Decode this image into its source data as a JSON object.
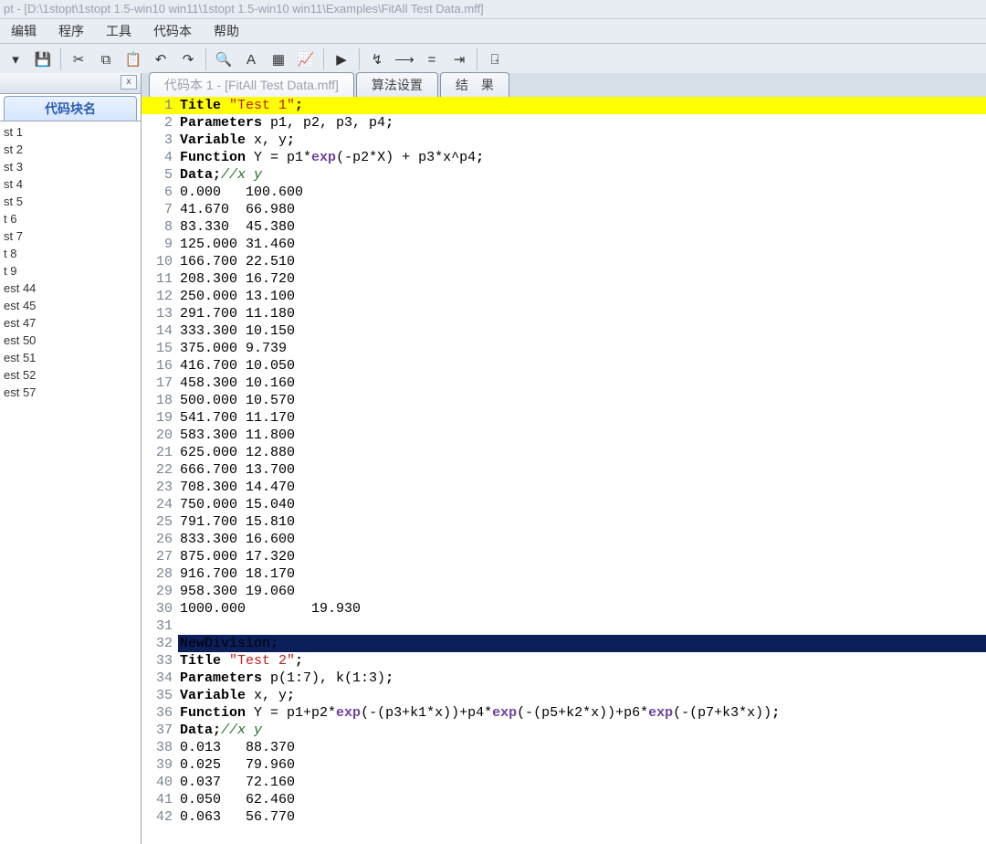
{
  "title": "pt - [D:\\1stopt\\1stopt 1.5-win10 win11\\1stopt 1.5-win10 win11\\Examples\\FitAll Test Data.mff]",
  "menu": [
    "编辑",
    "程序",
    "工具",
    "代码本",
    "帮助"
  ],
  "toolbar_icons": [
    {
      "name": "new-dropdown-icon",
      "glyph": "▾"
    },
    {
      "name": "save-icon",
      "glyph": "💾"
    },
    {
      "name": "sep"
    },
    {
      "name": "cut-icon",
      "glyph": "✂"
    },
    {
      "name": "copy-icon",
      "glyph": "⧉"
    },
    {
      "name": "paste-icon",
      "glyph": "📋"
    },
    {
      "name": "undo-icon",
      "glyph": "↶"
    },
    {
      "name": "redo-icon",
      "glyph": "↷"
    },
    {
      "name": "sep"
    },
    {
      "name": "find-icon",
      "glyph": "🔍"
    },
    {
      "name": "find-next-icon",
      "glyph": "A"
    },
    {
      "name": "sheet-icon",
      "glyph": "▦"
    },
    {
      "name": "chart-icon",
      "glyph": "📈"
    },
    {
      "name": "sep"
    },
    {
      "name": "run-icon",
      "glyph": "▶"
    },
    {
      "name": "sep"
    },
    {
      "name": "wand-icon",
      "glyph": "↯"
    },
    {
      "name": "step-icon",
      "glyph": "⟶"
    },
    {
      "name": "equals-icon",
      "glyph": "="
    },
    {
      "name": "advance-icon",
      "glyph": "⇥"
    },
    {
      "name": "sep"
    },
    {
      "name": "exit-icon",
      "glyph": "⍈"
    }
  ],
  "sidebar": {
    "tab_label": "代码块名",
    "close_x": "x",
    "items": [
      "st 1",
      "st 2",
      "st 3",
      "st 4",
      "st 5",
      "t 6",
      "st 7",
      "t 8",
      "t 9",
      "est 44",
      "est 45",
      "est 47",
      "est 50",
      "est 51",
      "est 52",
      "est 57"
    ]
  },
  "tabs": [
    {
      "label": "代码本 1 - [FitAll Test Data.mff]",
      "active": true
    },
    {
      "label": "算法设置",
      "active": false
    },
    {
      "label": "结　果",
      "active": false
    }
  ],
  "code": {
    "lines": [
      {
        "n": 1,
        "hl": "yellow",
        "tokens": [
          [
            "kw",
            "Title"
          ],
          [
            "sp",
            " "
          ],
          [
            "str",
            "\"Test 1\""
          ],
          [
            "op",
            ";"
          ]
        ]
      },
      {
        "n": 2,
        "tokens": [
          [
            "kw",
            "Parameters"
          ],
          [
            "sp",
            " "
          ],
          [
            "id",
            "p1, p2, p3, p4"
          ],
          [
            "op",
            ";"
          ]
        ]
      },
      {
        "n": 3,
        "tokens": [
          [
            "kw",
            "Variable"
          ],
          [
            "sp",
            " "
          ],
          [
            "id",
            "x, y"
          ],
          [
            "op",
            ";"
          ]
        ]
      },
      {
        "n": 4,
        "tokens": [
          [
            "kw",
            "Function"
          ],
          [
            "sp",
            " "
          ],
          [
            "id",
            "Y = p1*"
          ],
          [
            "fn",
            "exp"
          ],
          [
            "id",
            "(-p2*X) + p3*x^p4"
          ],
          [
            "op",
            ";"
          ]
        ]
      },
      {
        "n": 5,
        "tokens": [
          [
            "kw",
            "Data"
          ],
          [
            "op",
            ";"
          ],
          [
            "cm",
            "//x y"
          ]
        ]
      },
      {
        "n": 6,
        "tokens": [
          [
            "id",
            "0.000   100.600"
          ]
        ]
      },
      {
        "n": 7,
        "tokens": [
          [
            "id",
            "41.670  66.980"
          ]
        ]
      },
      {
        "n": 8,
        "tokens": [
          [
            "id",
            "83.330  45.380"
          ]
        ]
      },
      {
        "n": 9,
        "tokens": [
          [
            "id",
            "125.000 31.460"
          ]
        ]
      },
      {
        "n": 10,
        "tokens": [
          [
            "id",
            "166.700 22.510"
          ]
        ]
      },
      {
        "n": 11,
        "tokens": [
          [
            "id",
            "208.300 16.720"
          ]
        ]
      },
      {
        "n": 12,
        "tokens": [
          [
            "id",
            "250.000 13.100"
          ]
        ]
      },
      {
        "n": 13,
        "tokens": [
          [
            "id",
            "291.700 11.180"
          ]
        ]
      },
      {
        "n": 14,
        "tokens": [
          [
            "id",
            "333.300 10.150"
          ]
        ]
      },
      {
        "n": 15,
        "tokens": [
          [
            "id",
            "375.000 9.739"
          ]
        ]
      },
      {
        "n": 16,
        "tokens": [
          [
            "id",
            "416.700 10.050"
          ]
        ]
      },
      {
        "n": 17,
        "tokens": [
          [
            "id",
            "458.300 10.160"
          ]
        ]
      },
      {
        "n": 18,
        "tokens": [
          [
            "id",
            "500.000 10.570"
          ]
        ]
      },
      {
        "n": 19,
        "tokens": [
          [
            "id",
            "541.700 11.170"
          ]
        ]
      },
      {
        "n": 20,
        "tokens": [
          [
            "id",
            "583.300 11.800"
          ]
        ]
      },
      {
        "n": 21,
        "tokens": [
          [
            "id",
            "625.000 12.880"
          ]
        ]
      },
      {
        "n": 22,
        "tokens": [
          [
            "id",
            "666.700 13.700"
          ]
        ]
      },
      {
        "n": 23,
        "tokens": [
          [
            "id",
            "708.300 14.470"
          ]
        ]
      },
      {
        "n": 24,
        "tokens": [
          [
            "id",
            "750.000 15.040"
          ]
        ]
      },
      {
        "n": 25,
        "tokens": [
          [
            "id",
            "791.700 15.810"
          ]
        ]
      },
      {
        "n": 26,
        "tokens": [
          [
            "id",
            "833.300 16.600"
          ]
        ]
      },
      {
        "n": 27,
        "tokens": [
          [
            "id",
            "875.000 17.320"
          ]
        ]
      },
      {
        "n": 28,
        "tokens": [
          [
            "id",
            "916.700 18.170"
          ]
        ]
      },
      {
        "n": 29,
        "tokens": [
          [
            "id",
            "958.300 19.060"
          ]
        ]
      },
      {
        "n": 30,
        "tokens": [
          [
            "id",
            "1000.000        19.930"
          ]
        ]
      },
      {
        "n": 31,
        "tokens": [
          [
            "id",
            ""
          ]
        ]
      },
      {
        "n": 32,
        "hl": "navy",
        "tokens": [
          [
            "id",
            "NewDivision;"
          ]
        ]
      },
      {
        "n": 33,
        "tokens": [
          [
            "kw",
            "Title"
          ],
          [
            "sp",
            " "
          ],
          [
            "str",
            "\"Test 2\""
          ],
          [
            "op",
            ";"
          ]
        ]
      },
      {
        "n": 34,
        "tokens": [
          [
            "kw",
            "Parameters"
          ],
          [
            "sp",
            " "
          ],
          [
            "id",
            "p(1:7), k(1:3)"
          ],
          [
            "op",
            ";"
          ]
        ]
      },
      {
        "n": 35,
        "tokens": [
          [
            "kw",
            "Variable"
          ],
          [
            "sp",
            " "
          ],
          [
            "id",
            "x, y"
          ],
          [
            "op",
            ";"
          ]
        ]
      },
      {
        "n": 36,
        "tokens": [
          [
            "kw",
            "Function"
          ],
          [
            "sp",
            " "
          ],
          [
            "id",
            "Y = p1+p2*"
          ],
          [
            "fn",
            "exp"
          ],
          [
            "id",
            "(-(p3+k1*x))+p4*"
          ],
          [
            "fn",
            "exp"
          ],
          [
            "id",
            "(-(p5+k2*x))+p6*"
          ],
          [
            "fn",
            "exp"
          ],
          [
            "id",
            "(-(p7+k3*x))"
          ],
          [
            "op",
            ";"
          ]
        ]
      },
      {
        "n": 37,
        "tokens": [
          [
            "kw",
            "Data"
          ],
          [
            "op",
            ";"
          ],
          [
            "cm",
            "//x y"
          ]
        ]
      },
      {
        "n": 38,
        "tokens": [
          [
            "id",
            "0.013   88.370"
          ]
        ]
      },
      {
        "n": 39,
        "tokens": [
          [
            "id",
            "0.025   79.960"
          ]
        ]
      },
      {
        "n": 40,
        "tokens": [
          [
            "id",
            "0.037   72.160"
          ]
        ]
      },
      {
        "n": 41,
        "tokens": [
          [
            "id",
            "0.050   62.460"
          ]
        ]
      },
      {
        "n": 42,
        "tokens": [
          [
            "id",
            "0.063   56.770"
          ]
        ]
      }
    ]
  }
}
